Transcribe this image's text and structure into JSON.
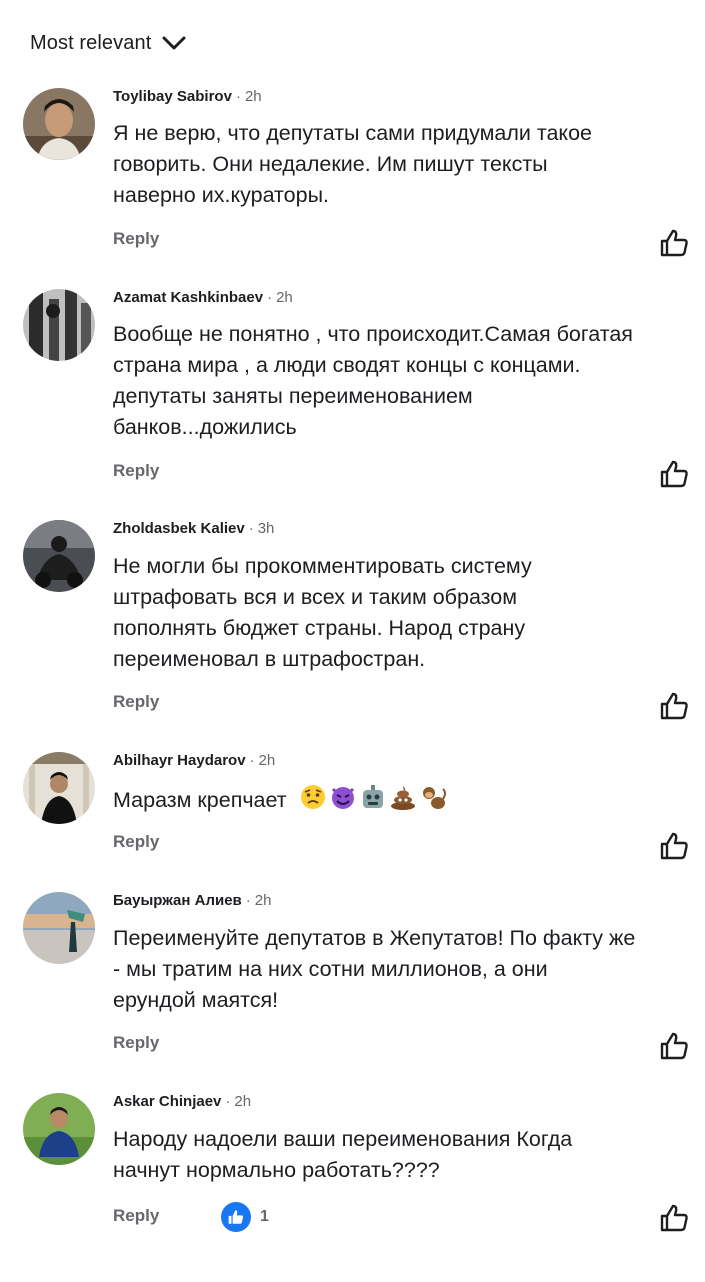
{
  "sort": {
    "label": "Most relevant",
    "icon": "chevron-down-icon"
  },
  "reply_label": "Reply",
  "comments": [
    {
      "author": "Toylibay Sabirov",
      "time": "2h",
      "lines": [
        "Я не верю, что депутаты сами придумали такое",
        "говорить. Они недалекие. Им пишут тексты",
        "наверно их.кураторы."
      ]
    },
    {
      "author": "Azamat Kashkinbaev",
      "time": "2h",
      "lines": [
        "Вообще не понятно , что происходит.Самая богатая",
        "страна мира , а люди сводят концы с концами.",
        "депутаты заняты переименованием",
        "банков...дожились"
      ]
    },
    {
      "author": "Zholdasbek Kaliev",
      "time": "3h",
      "lines": [
        "Не могли бы прокомментировать систему",
        "штрафовать вся и всех и таким образом",
        "пополнять бюджет страны. Народ страну",
        "переименовал в штрафостран."
      ]
    },
    {
      "author": "Abilhayr Haydarov",
      "time": "2h",
      "lines": [
        "Маразм крепчает"
      ],
      "emojis": [
        "worried-face-emoji",
        "smiling-devil-emoji",
        "robot-emoji",
        "pile-of-poo-emoji",
        "monkey-emoji"
      ]
    },
    {
      "author": "Бауыржан Алиев",
      "time": "2h",
      "lines": [
        "Переименуйте депутатов в Жепутатов! По факту же",
        "- мы тратим на них сотни миллионов, а они",
        "ерундой маятся!"
      ]
    },
    {
      "author": "Askar Chinjaev",
      "time": "2h",
      "lines": [
        "Народу надоели  ваши переименования Когда",
        "начнут нормально  работать????"
      ],
      "reactions": {
        "icon": "like-reaction-icon",
        "count": "1"
      }
    }
  ],
  "colors": {
    "text": "#1c1e21",
    "secondary": "#65676b",
    "like_blue": "#1877f2"
  }
}
